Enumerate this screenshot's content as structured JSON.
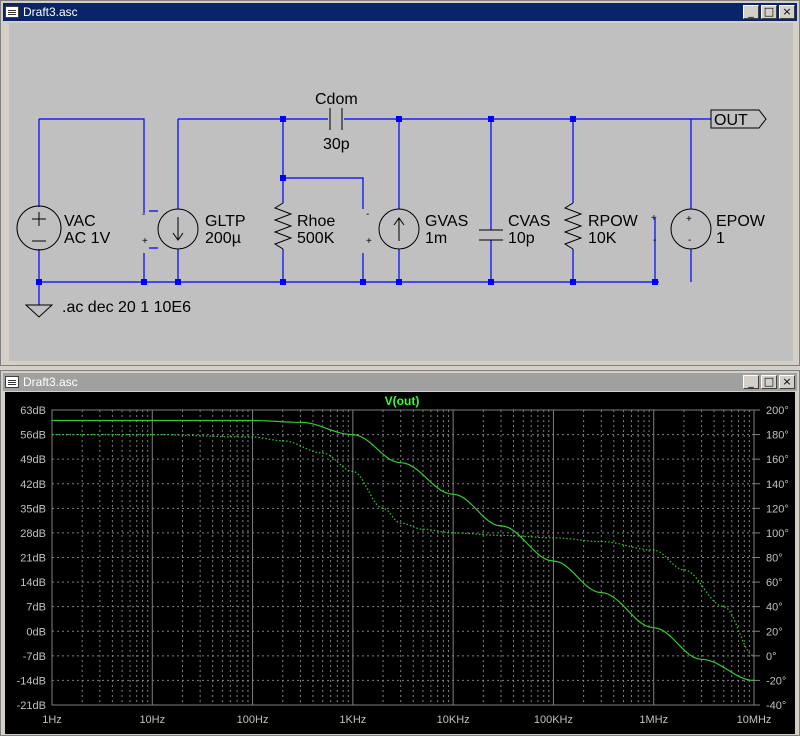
{
  "schematic_window": {
    "title": "Draft3.asc",
    "buttons": {
      "minimize": "_",
      "restore": "□",
      "close": "×"
    }
  },
  "plot_window": {
    "title": "Draft3.asc",
    "buttons": {
      "minimize": "_",
      "restore": "□",
      "close": "×"
    }
  },
  "schematic": {
    "components": {
      "vac": {
        "name": "VAC",
        "value": "AC 1V"
      },
      "gltp": {
        "name": "GLTP",
        "value": "200µ"
      },
      "rhoe": {
        "name": "Rhoe",
        "value": "500K"
      },
      "gvas": {
        "name": "GVAS",
        "value": "1m"
      },
      "cvas": {
        "name": "CVAS",
        "value": "10p"
      },
      "rpow": {
        "name": "RPOW",
        "value": "10K"
      },
      "epow": {
        "name": "EPOW",
        "value": "1"
      },
      "cdom": {
        "name": "Cdom",
        "value": "30p"
      }
    },
    "out_label": "OUT",
    "directive": ".ac dec 20 1 10E6",
    "pin_plus": "+",
    "pin_minus": "-",
    "colors": {
      "wire": "#0000ff",
      "junction": "#0000ff",
      "label": "#000000"
    }
  },
  "chart_data": {
    "type": "line",
    "title": "V(out)",
    "x_scale": "log",
    "xlim": [
      1,
      10000000
    ],
    "x_ticks": [
      1,
      10,
      100,
      1000,
      10000,
      100000,
      1000000,
      10000000
    ],
    "x_tick_labels": [
      "1Hz",
      "10Hz",
      "100Hz",
      "1KHz",
      "10KHz",
      "100KHz",
      "1MHz",
      "10MHz"
    ],
    "y_left": {
      "min": -21,
      "max": 63,
      "ticks": [
        63,
        56,
        49,
        42,
        35,
        28,
        21,
        14,
        7,
        0,
        -7,
        -14,
        -21
      ],
      "tick_labels": [
        "63dB",
        "56dB",
        "49dB",
        "42dB",
        "35dB",
        "28dB",
        "21dB",
        "14dB",
        "7dB",
        "0dB",
        "-7dB",
        "-14dB",
        "-21dB"
      ]
    },
    "y_right": {
      "min": -40,
      "max": 200,
      "ticks": [
        200,
        180,
        160,
        140,
        120,
        100,
        80,
        60,
        40,
        20,
        0,
        -20,
        -40
      ],
      "tick_labels": [
        "200°",
        "180°",
        "160°",
        "140°",
        "120°",
        "100°",
        "80°",
        "60°",
        "40°",
        "20°",
        "0°",
        "-20°",
        "-40°"
      ]
    },
    "grid": true,
    "colors": {
      "background": "#000000",
      "trace": "#33cc33",
      "title": "#33ff33",
      "grid": "#808080",
      "axis_text": "#c0c0c0"
    },
    "series": [
      {
        "name": "V(out)",
        "axis": "left",
        "style": "solid",
        "x": [
          1,
          10,
          100,
          300,
          1000,
          3000,
          10000,
          30000,
          100000,
          300000,
          1000000,
          3000000,
          10000000
        ],
        "y": [
          60,
          60,
          60,
          59.5,
          56,
          48,
          39,
          30,
          20,
          11,
          1,
          -8,
          -14
        ]
      },
      {
        "name": "",
        "axis": "right",
        "style": "dotted",
        "x": [
          1,
          10,
          100,
          200,
          500,
          1000,
          2000,
          3000,
          5000,
          10000,
          30000,
          100000,
          300000,
          1000000,
          2000000,
          5000000,
          10000000
        ],
        "y": [
          180,
          180,
          178,
          175,
          165,
          150,
          120,
          108,
          103,
          100,
          98,
          96,
          93,
          86,
          70,
          40,
          0
        ]
      }
    ]
  }
}
